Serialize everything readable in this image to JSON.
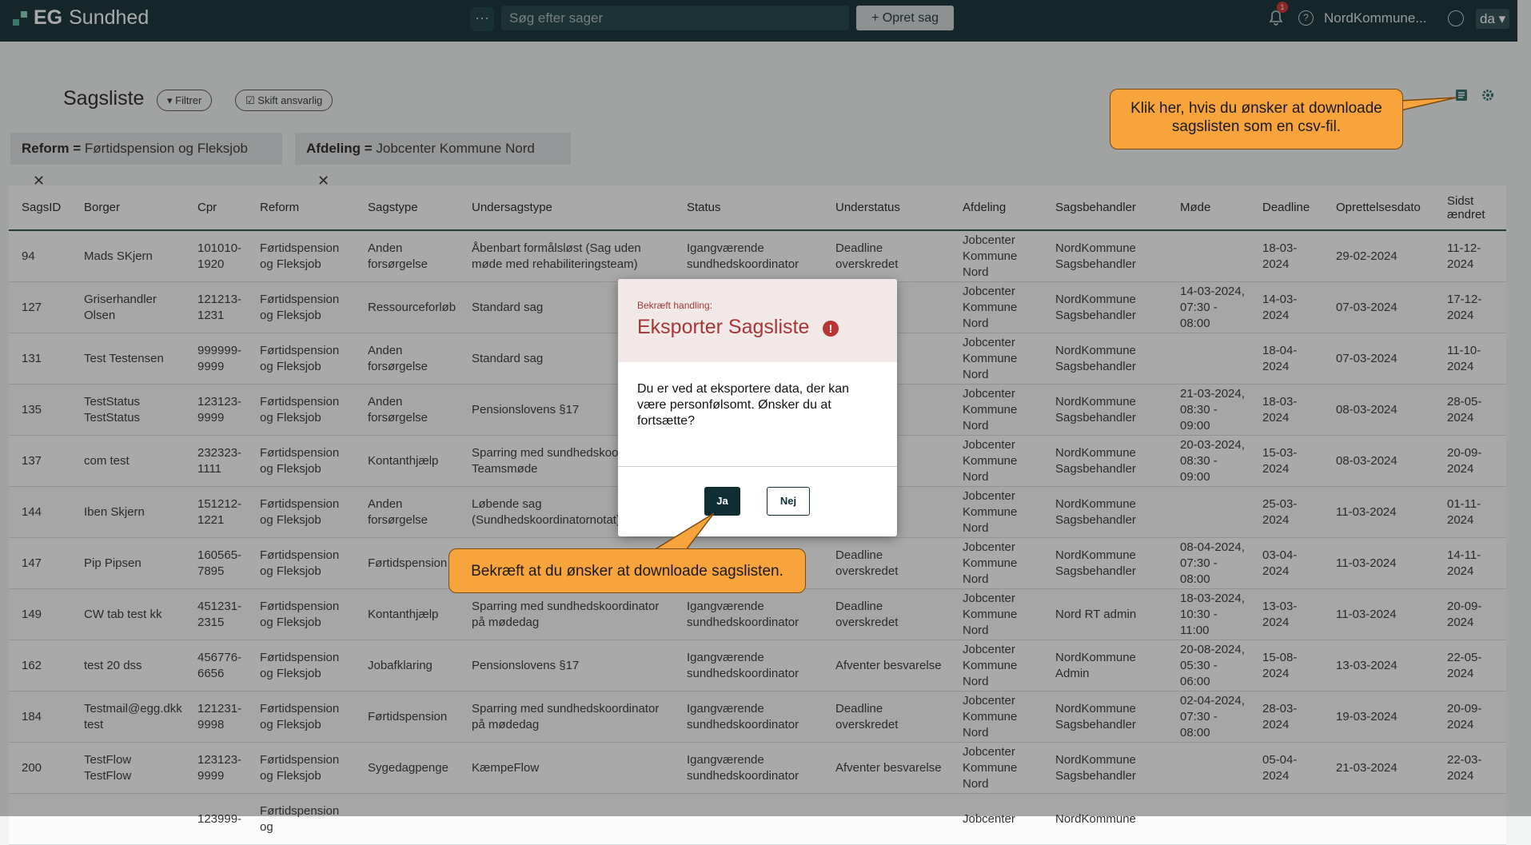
{
  "topbar": {
    "logo_bold": "EG",
    "logo_text": "Sundhed",
    "more_label": "···",
    "search_placeholder": "Søg efter sager",
    "new_case_label": "+ Opret sag",
    "notification_count": "1",
    "help_label": "?",
    "tenant": "NordKommune...",
    "language": "da ▾"
  },
  "page": {
    "title": "Sagsliste",
    "filter_label": "Filtrer",
    "change_owner_label": "Skift ansvarlig",
    "chips": [
      {
        "key": "Reform =",
        "value": "Førtidspension og Fleksjob",
        "close": "✕"
      },
      {
        "key": "Afdeling =",
        "value": "Jobcenter Kommune Nord",
        "close": "✕"
      }
    ]
  },
  "table": {
    "headers": [
      "SagsID",
      "Borger",
      "Cpr",
      "Reform",
      "Sagstype",
      "Undersagstype",
      "Status",
      "Understatus",
      "Afdeling",
      "Sagsbehandler",
      "Møde",
      "Deadline",
      "Oprettelsesdato",
      "Sidst ændret"
    ],
    "rows": [
      [
        "94",
        "Mads SKjern",
        "101010-1920",
        "Førtidspension og Fleksjob",
        "Anden forsørgelse",
        "Åbenbart formålsløst (Sag uden møde med rehabiliteringsteam)",
        "Igangværende sundhedskoordinator",
        "Deadline overskredet",
        "Jobcenter Kommune Nord",
        "NordKommune Sagsbehandler",
        "",
        "18-03-2024",
        "29-02-2024",
        "11-12-2024"
      ],
      [
        "127",
        "Griserhandler Olsen",
        "121213-1231",
        "Førtidspension og Fleksjob",
        "Ressourceforløb",
        "Standard sag",
        "",
        "",
        "Jobcenter Kommune Nord",
        "NordKommune Sagsbehandler",
        "14-03-2024, 07:30 - 08:00",
        "14-03-2024",
        "07-03-2024",
        "17-12-2024"
      ],
      [
        "131",
        "Test Testensen",
        "999999-9999",
        "Førtidspension og Fleksjob",
        "Anden forsørgelse",
        "Standard sag",
        "",
        "tion",
        "Jobcenter Kommune Nord",
        "NordKommune Sagsbehandler",
        "",
        "18-04-2024",
        "07-03-2024",
        "11-10-2024"
      ],
      [
        "135",
        "TestStatus TestStatus",
        "123123-9999",
        "Førtidspension og Fleksjob",
        "Anden forsørgelse",
        "Pensionslovens §17",
        "",
        "gsteam",
        "Jobcenter Kommune Nord",
        "NordKommune Sagsbehandler",
        "21-03-2024, 08:30 - 09:00",
        "18-03-2024",
        "08-03-2024",
        "28-05-2024"
      ],
      [
        "137",
        "com test",
        "232323-1111",
        "Førtidspension og Fleksjob",
        "Kontanthjælp",
        "Sparring med sundhedskoor over Teamsmøde",
        "",
        "rskredet",
        "Jobcenter Kommune Nord",
        "NordKommune Sagsbehandler",
        "20-03-2024, 08:30 - 09:00",
        "15-03-2024",
        "08-03-2024",
        "20-09-2024"
      ],
      [
        "144",
        "Iben Skjern",
        "151212-1221",
        "Førtidspension og Fleksjob",
        "Anden forsørgelse",
        "Løbende sag (Sundhedskoordinatornotat)",
        "",
        "ordinator",
        "Jobcenter Kommune Nord",
        "NordKommune Sagsbehandler",
        "",
        "25-03-2024",
        "11-03-2024",
        "01-11-2024"
      ],
      [
        "147",
        "Pip Pipsen",
        "160565-7895",
        "Førtidspension og Fleksjob",
        "Førtidspension",
        "",
        "",
        "Deadline overskredet",
        "Jobcenter Kommune Nord",
        "NordKommune Sagsbehandler",
        "08-04-2024, 07:30 - 08:00",
        "03-04-2024",
        "11-03-2024",
        "14-11-2024"
      ],
      [
        "149",
        "CW tab test kk",
        "451231-2315",
        "Førtidspension og Fleksjob",
        "Kontanthjælp",
        "Sparring med sundhedskoordinator på mødedag",
        "Igangværende sundhedskoordinator",
        "Deadline overskredet",
        "Jobcenter Kommune Nord",
        "Nord RT admin",
        "18-03-2024, 10:30 - 11:00",
        "13-03-2024",
        "11-03-2024",
        "20-09-2024"
      ],
      [
        "162",
        "test 20 dss",
        "456776-6656",
        "Førtidspension og Fleksjob",
        "Jobafklaring",
        "Pensionslovens §17",
        "Igangværende sundhedskoordinator",
        "Afventer besvarelse",
        "Jobcenter Kommune Nord",
        "NordKommune Admin",
        "20-08-2024, 05:30 - 06:00",
        "15-08-2024",
        "13-03-2024",
        "22-05-2024"
      ],
      [
        "184",
        "Testmail@egg.dkk test",
        "121231-9998",
        "Førtidspension og Fleksjob",
        "Førtidspension",
        "Sparring med sundhedskoordinator på mødedag",
        "Igangværende sundhedskoordinator",
        "Deadline overskredet",
        "Jobcenter Kommune Nord",
        "NordKommune Sagsbehandler",
        "02-04-2024, 07:30 - 08:00",
        "28-03-2024",
        "19-03-2024",
        "20-09-2024"
      ],
      [
        "200",
        "TestFlow TestFlow",
        "123123-9999",
        "Førtidspension og Fleksjob",
        "Sygedagpenge",
        "KæmpeFlow",
        "Igangværende sundhedskoordinator",
        "Afventer besvarelse",
        "Jobcenter Kommune Nord",
        "NordKommune Sagsbehandler",
        "",
        "05-04-2024",
        "21-03-2024",
        "22-03-2024"
      ],
      [
        "",
        "",
        "123999-",
        "Førtidspension og",
        "",
        "",
        "",
        "",
        "Jobcenter",
        "NordKommune",
        "",
        "",
        "",
        ""
      ]
    ]
  },
  "dialog": {
    "kicker": "Bekræft handling:",
    "title": "Eksporter Sagsliste",
    "warn": "!",
    "body": "Du er ved at eksportere data, der kan være personfølsomt. Ønsker du at fortsætte?",
    "yes": "Ja",
    "no": "Nej"
  },
  "callouts": {
    "download": "Klik her, hvis du ønsker at downloade sagslisten som en csv-fil.",
    "confirm": "Bekræft at du ønsker at downloade sagslisten."
  },
  "colors": {
    "topbar": "#0f2d33",
    "callout": "#f7a43c",
    "danger": "#a83636"
  }
}
